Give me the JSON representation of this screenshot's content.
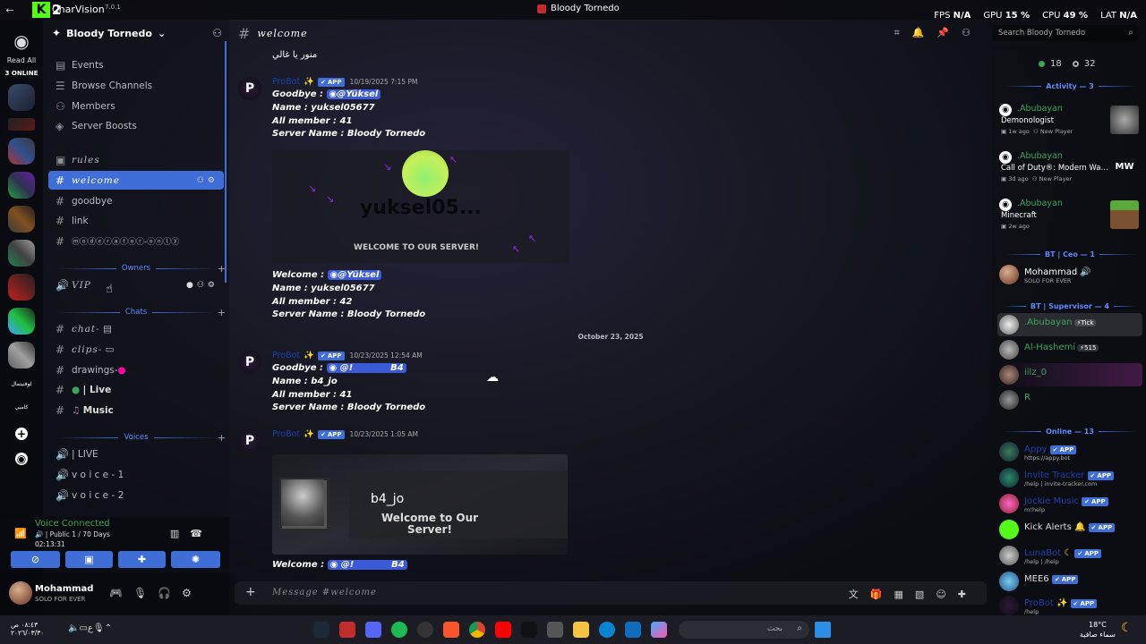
{
  "topbar": {
    "app_name": "CharVision",
    "version": "7.0.1",
    "window_title": "Bloody Tornedo",
    "fps_label": "FPS",
    "fps": "N/A",
    "gpu_label": "GPU",
    "gpu": "15 %",
    "cpu_label": "CPU",
    "cpu": "49 %",
    "lat_label": "LAT",
    "lat": "N/A"
  },
  "servers": {
    "read_all": "Read All",
    "online": "3 ONLINE",
    "label1": "CONSOLES",
    "label2": "لوفنيتمال",
    "label3": "كامبي"
  },
  "guild": {
    "name": "Bloody Tornedo"
  },
  "channels": {
    "events": "Events",
    "browse": "Browse Channels",
    "members": "Members",
    "boosts": "Server Boosts",
    "rules": "rules",
    "welcome": "welcome",
    "goodbye": "goodbye",
    "link": "link",
    "moderator": "ⓜⓞⓓⓔⓡⓐⓣⓞⓡ-ⓞⓝⓛⓨ",
    "cat_owners": "Owners",
    "vip": "VIP",
    "cat_chats": "Chats",
    "chat": "chat-",
    "clips": "clips-",
    "drawings": "drawings-",
    "live": "| Live",
    "music": "Music",
    "cat_voices": "Voices",
    "vlive": "| LIVE",
    "voice1": "v o i c e - 1",
    "voice2": "v o i c e - 2"
  },
  "voice": {
    "status": "Voice Connected",
    "channel": "| Public 1 / 70 Days",
    "time": "02:13:31"
  },
  "user": {
    "name": "Mohammad",
    "status": "SOLO FOR EVER"
  },
  "chat": {
    "channel": "welcome",
    "search_placeholder": "Search Bloody Tornedo",
    "composer_placeholder": "Message #welcome",
    "top_arabic": "منور يا غالي",
    "date_sep": "October 23, 2025"
  },
  "messages": [
    {
      "author": "ProBot",
      "badge": "APP",
      "time": "10/19/2025 7:15 PM",
      "lines": [
        "Goodbye :",
        "Name : yuksel05677",
        "All member : 41",
        "Server Name : Bloody Tornedo"
      ],
      "mention": "@Yüksel",
      "embed_name": "yuksel05...",
      "embed_welcome": "WELCOME TO OUR SERVER!",
      "lines2": [
        "Welcome :",
        "Name : yuksel05677",
        "All member : 42",
        "Server Name : Bloody Tornedo"
      ]
    },
    {
      "author": "ProBot",
      "badge": "APP",
      "time": "10/23/2025 12:54 AM",
      "lines": [
        "Goodbye :",
        "Name : b4_jo",
        "All member : 41",
        "Server Name : Bloody Tornedo"
      ],
      "mention": "@!",
      "mention_tail": "B4"
    },
    {
      "author": "ProBot",
      "badge": "APP",
      "time": "10/23/2025 1:05 AM",
      "embed_name": "b4_jo",
      "embed_welcome": "Welcome to Our Server!",
      "last_line": "Welcome :"
    }
  ],
  "members": {
    "online_count": "18",
    "total_count": "32",
    "activity_header": "Activity — 3",
    "activities": [
      {
        "name": ".Abubayan",
        "game": "Demonologist",
        "meta": "1w ago",
        "tag": "New Player"
      },
      {
        "name": ".Abubayan",
        "game": "Call of Duty®: Modern War...",
        "meta": "3d ago",
        "tag": "New Player"
      },
      {
        "name": ".Abubayan",
        "game": "Minecraft",
        "meta": "2w ago",
        "tag": ""
      }
    ],
    "ceo_header": "BT | Ceo — 1",
    "ceo": [
      {
        "name": "Mohammad",
        "sub": "SOLO FOR EVER"
      }
    ],
    "sup_header": "BT | Supervisor — 4",
    "sup": [
      {
        "name": ".Abubayan",
        "tag": "Tick"
      },
      {
        "name": "Al-Hashemi",
        "tag": "515"
      },
      {
        "name": "iilz_0",
        "tag": ""
      },
      {
        "name": "R",
        "tag": ""
      }
    ],
    "online_header": "Online — 13",
    "online": [
      {
        "name": "Appy",
        "badge": "APP",
        "sub": "https://appy.bot"
      },
      {
        "name": "Invite Tracker",
        "badge": "APP",
        "sub": "/help | invite-tracker.com"
      },
      {
        "name": "Jockie Music",
        "badge": "APP",
        "sub": "m!help"
      },
      {
        "name": "Kick Alerts",
        "badge": "APP",
        "sub": ""
      },
      {
        "name": "LunaBot",
        "badge": "APP",
        "sub": "/help | /help"
      },
      {
        "name": "MEE6",
        "badge": "APP",
        "sub": ""
      },
      {
        "name": "ProBot",
        "badge": "APP",
        "sub": "/help"
      }
    ]
  },
  "taskbar": {
    "time": "٠٨:٤٣ ص",
    "date": "٢٠٢٦/٠٣/٣٠",
    "search": "بحث",
    "temp": "18°C",
    "weather": "سماء صافية"
  }
}
